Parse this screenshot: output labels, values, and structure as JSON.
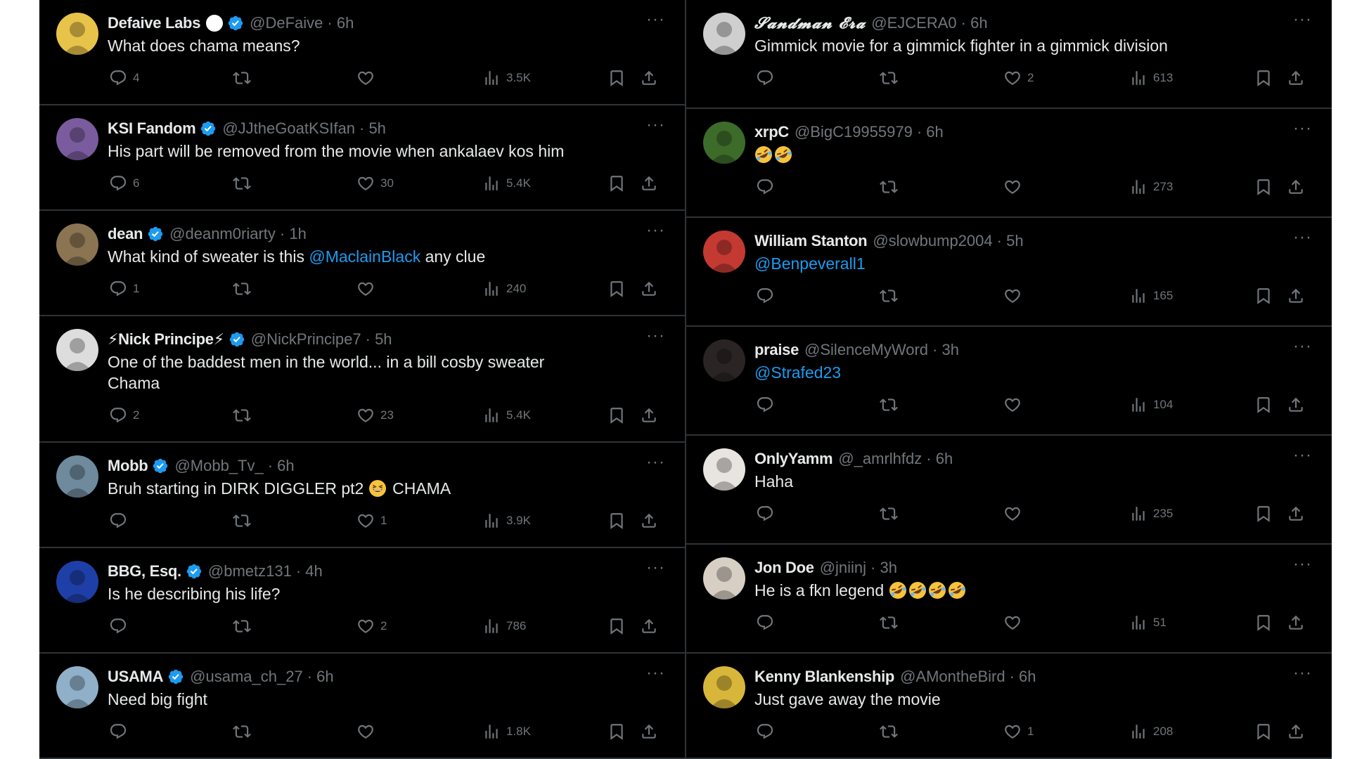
{
  "left": [
    {
      "name": "Defaive Labs",
      "white_circle": true,
      "verified": true,
      "handle": "@DeFaive",
      "time": "· 6h",
      "text_parts": [
        {
          "t": "What does chama means?"
        }
      ],
      "replies": "4",
      "likes": "",
      "views": "3.5K",
      "avatar_color": "#e8c34a"
    },
    {
      "name": "KSI Fandom",
      "verified": true,
      "handle": "@JJtheGoatKSIfan",
      "time": "· 5h",
      "text_parts": [
        {
          "t": "His part will be removed from the movie when ankalaev kos him"
        }
      ],
      "replies": "6",
      "likes": "30",
      "views": "5.4K",
      "avatar_color": "#7a5c9e"
    },
    {
      "name": "dean",
      "verified": true,
      "handle": "@deanm0riarty",
      "time": "· 1h",
      "text_parts": [
        {
          "t": "What kind of sweater is this "
        },
        {
          "t": "@MaclainBlack",
          "mention": true
        },
        {
          "t": " any clue"
        }
      ],
      "replies": "1",
      "likes": "",
      "views": "240",
      "avatar_color": "#8a7452"
    },
    {
      "name": "⚡Nick Principe⚡",
      "verified": true,
      "handle": "@NickPrincipe7",
      "time": "· 5h",
      "text_parts": [
        {
          "t": "One of the baddest men in the world... in a bill cosby sweater\nChama"
        }
      ],
      "replies": "2",
      "likes": "23",
      "views": "5.4K",
      "avatar_color": "#dddddd"
    },
    {
      "name": "Mobb",
      "verified": true,
      "handle": "@Mobb_Tv_",
      "time": "· 6h",
      "text_parts": [
        {
          "t": "Bruh starting in DIRK DIGGLER pt2 "
        },
        {
          "emoji": "grin"
        },
        {
          "t": " CHAMA"
        }
      ],
      "replies": "",
      "likes": "1",
      "views": "3.9K",
      "avatar_color": "#6e8a9c"
    },
    {
      "name": "BBG, Esq.",
      "verified": true,
      "handle": "@bmetz131",
      "time": "· 4h",
      "text_parts": [
        {
          "t": "Is he describing his life?"
        }
      ],
      "replies": "",
      "likes": "2",
      "views": "786",
      "avatar_color": "#1f3fa8"
    },
    {
      "name": "USAMA",
      "verified": true,
      "handle": "@usama_ch_27",
      "time": "· 6h",
      "text_parts": [
        {
          "t": "Need big fight"
        }
      ],
      "replies": "",
      "likes": "",
      "views": "1.8K",
      "avatar_color": "#8fb0c8"
    }
  ],
  "right": [
    {
      "name": "𝓢𝓪𝓷𝓭𝓶𝓪𝓷 𝓔𝓻𝓪",
      "script": true,
      "handle": "@EJCERA0",
      "time": "· 6h",
      "text_parts": [
        {
          "t": "Gimmick movie for a gimmick fighter in a gimmick division"
        }
      ],
      "replies": "",
      "likes": "2",
      "views": "613",
      "avatar_color": "#cfcfcf"
    },
    {
      "name": "xrpC",
      "handle": "@BigC19955979",
      "time": "· 6h",
      "text_parts": [
        {
          "emoji": "rofl"
        },
        {
          "emoji": "rofl"
        }
      ],
      "replies": "",
      "likes": "",
      "views": "273",
      "avatar_color": "#3d6b2a"
    },
    {
      "name": "William Stanton",
      "handle": "@slowbump2004",
      "time": "· 5h",
      "text_parts": [
        {
          "t": "@Benpeverall1",
          "mention": true
        }
      ],
      "replies": "",
      "likes": "",
      "views": "165",
      "avatar_color": "#c43a32"
    },
    {
      "name": "praise",
      "handle": "@SilenceMyWord",
      "time": "· 3h",
      "text_parts": [
        {
          "t": "@Strafed23",
          "mention": true
        }
      ],
      "replies": "",
      "likes": "",
      "views": "104",
      "avatar_color": "#2a2424"
    },
    {
      "name": "OnlyYamm",
      "handle": "@_amrlhfdz",
      "time": "· 6h",
      "text_parts": [
        {
          "t": "Haha"
        }
      ],
      "replies": "",
      "likes": "",
      "views": "235",
      "avatar_color": "#e8e4df"
    },
    {
      "name": "Jon Doe",
      "handle": "@jniinj",
      "time": "· 3h",
      "text_parts": [
        {
          "t": "He is a fkn legend "
        },
        {
          "emoji": "rofl"
        },
        {
          "emoji": "rofl"
        },
        {
          "emoji": "rofl"
        },
        {
          "emoji": "rofl"
        }
      ],
      "replies": "",
      "likes": "",
      "views": "51",
      "avatar_color": "#d8cfc4"
    },
    {
      "name": "Kenny Blankenship",
      "handle": "@AMontheBird",
      "time": "· 6h",
      "text_parts": [
        {
          "t": "Just gave away the movie"
        }
      ],
      "replies": "",
      "likes": "1",
      "views": "208",
      "avatar_color": "#d8b63a"
    }
  ],
  "icons": {
    "more": "more-dots-icon",
    "reply": "reply-icon",
    "retweet": "retweet-icon",
    "like": "heart-icon",
    "views": "views-icon",
    "bookmark": "bookmark-icon",
    "share": "share-icon"
  },
  "colors": {
    "background": "#000000",
    "text": "#e7e9ea",
    "secondary": "#71767b",
    "accent": "#1d9bf0",
    "divider": "#2f3336"
  },
  "more_label": "···"
}
